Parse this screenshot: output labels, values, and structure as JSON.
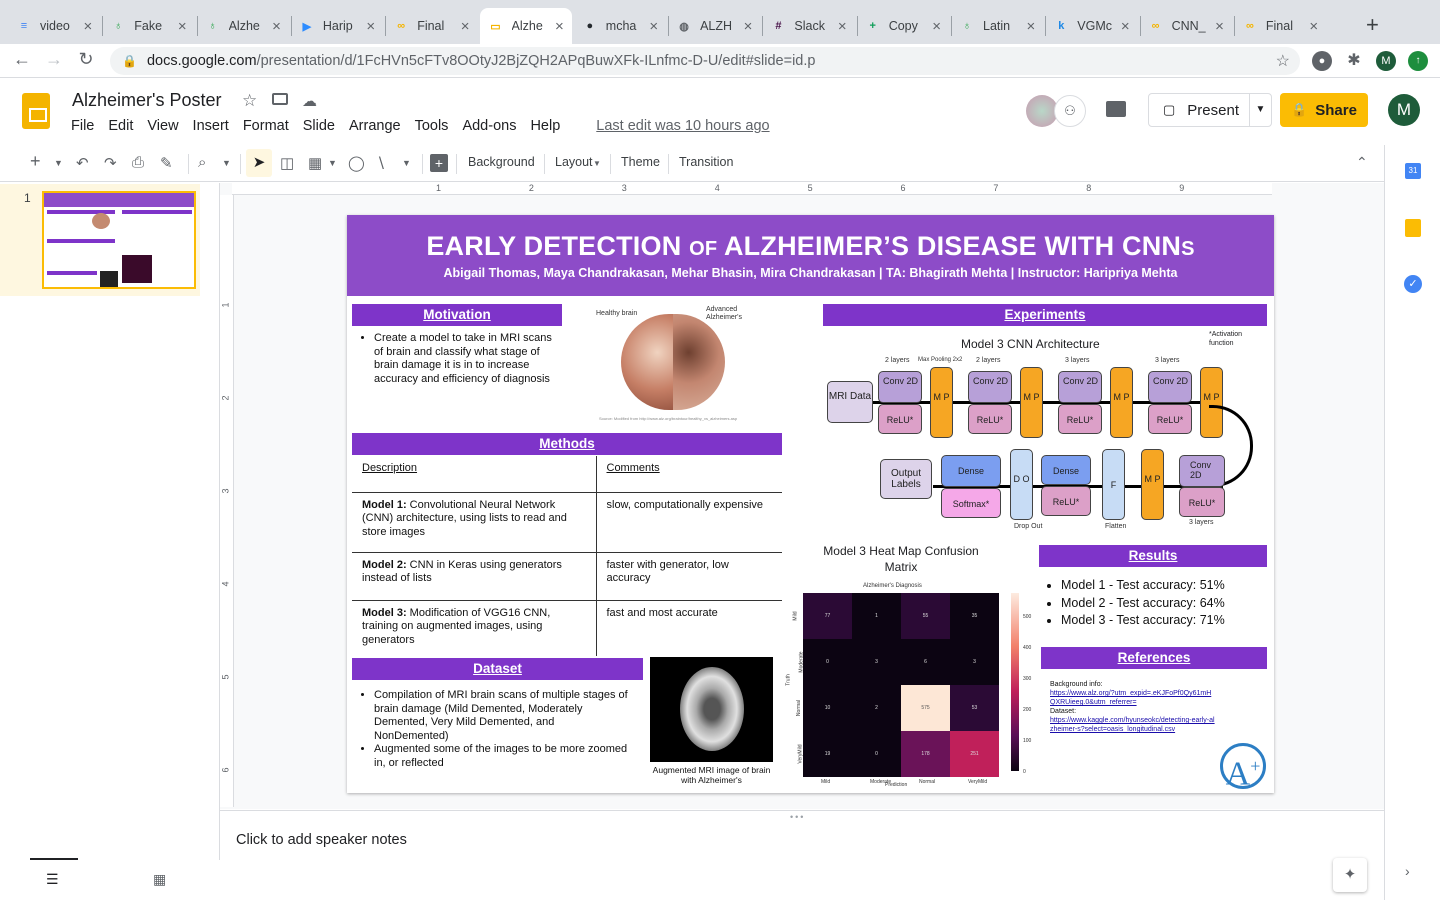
{
  "browser": {
    "tabs": [
      {
        "label": "video",
        "icon": "docs-icon",
        "color": "#4285f4"
      },
      {
        "label": "Fake",
        "icon": "leaf-icon",
        "color": "#34a853"
      },
      {
        "label": "Alzhe",
        "icon": "leaf-icon",
        "color": "#34a853"
      },
      {
        "label": "Harip",
        "icon": "zoom-icon",
        "color": "#2d8cff"
      },
      {
        "label": "Final",
        "icon": "infinity-icon",
        "color": "#f4b400"
      },
      {
        "label": "Alzhe",
        "icon": "slides-icon",
        "color": "#f4b400",
        "active": true
      },
      {
        "label": "mcha",
        "icon": "github-icon",
        "color": "#24292e"
      },
      {
        "label": "ALZH",
        "icon": "globe-icon",
        "color": "#5f6368"
      },
      {
        "label": "Slack",
        "icon": "slack-icon",
        "color": "#4a154b"
      },
      {
        "label": "Copy",
        "icon": "sheets-icon",
        "color": "#0f9d58"
      },
      {
        "label": "Latin",
        "icon": "leaf-icon",
        "color": "#34a853"
      },
      {
        "label": "VGMc",
        "icon": "k-icon",
        "color": "#1e88e5"
      },
      {
        "label": "CNN_",
        "icon": "infinity-icon",
        "color": "#f4b400"
      },
      {
        "label": "Final",
        "icon": "infinity-icon",
        "color": "#f4b400"
      }
    ],
    "url_host": "docs.google.com",
    "url_path": "/presentation/d/1FcHVn5cFTv8OOtyJ2BjZQH2APqBuwXFk-ILnfmc-D-U/edit#slide=id.p",
    "profile_initial": "M"
  },
  "app": {
    "doc_title": "Alzheimer's Poster",
    "menu": [
      "File",
      "Edit",
      "View",
      "Insert",
      "Format",
      "Slide",
      "Arrange",
      "Tools",
      "Add-ons",
      "Help"
    ],
    "last_edit": "Last edit was 10 hours ago",
    "present_label": "Present",
    "share_label": "Share",
    "avatar_initial": "M"
  },
  "toolbar": {
    "background": "Background",
    "layout": "Layout",
    "theme": "Theme",
    "transition": "Transition"
  },
  "filmstrip": {
    "slide_number": "1"
  },
  "ruler": {
    "top": [
      "1",
      "2",
      "3",
      "4",
      "5",
      "6",
      "7",
      "8",
      "9"
    ],
    "left": [
      "1",
      "2",
      "3",
      "4",
      "5",
      "6"
    ]
  },
  "poster": {
    "title_part1": "EARLY DETECTION",
    "title_of": "OF",
    "title_part2": "ALZHEIMER’S DISEASE WITH CNN",
    "title_s": "S",
    "authors": "Abigail Thomas, Maya Chandrakasan, Mehar Bhasin, Mira Chandrakasan | TA: Bhagirath Mehta | Instructor: Haripriya Mehta",
    "motivation": {
      "heading": "Motivation",
      "text": "Create a model to take in MRI scans of brain and classify what stage of brain damage it is in to increase accuracy and efficiency of diagnosis",
      "img_left": "Healthy brain",
      "img_right": "Advanced Alzheimer's",
      "img_source": "Source: Modified from http://www.alz.org/braintour/healthy_vs_alzheimers.asp"
    },
    "methods": {
      "heading": "Methods",
      "col1": "Description",
      "col2": "Comments",
      "rows": [
        {
          "bold": "Model 1:",
          "desc": " Convolutional Neural Network (CNN) architecture, using lists to read and store images",
          "comment": "slow, computationally expensive"
        },
        {
          "bold": "Model 2:",
          "desc": " CNN in Keras using generators instead of lists",
          "comment": "faster with generator, low accuracy"
        },
        {
          "bold": "Model 3:",
          "desc": " Modification of VGG16 CNN, training on augmented images, using generators",
          "comment": "fast and most accurate"
        }
      ]
    },
    "dataset": {
      "heading": "Dataset",
      "bullets": [
        "Compilation of MRI brain scans of multiple stages of brain damage (Mild Demented, Moderately Demented, Very Mild Demented, and NonDemented)",
        "Augmented some of the images to be more zoomed in, or reflected"
      ],
      "caption": "Augmented MRI image of brain with Alzheimer's"
    },
    "experiments": {
      "heading": "Experiments",
      "arch_title": "Model 3 CNN Architecture",
      "activation_note": "*Activation function",
      "mri": "MRI Data",
      "conv": "Conv 2D",
      "relu": "ReLU*",
      "mp": "M P",
      "two_layers": "2 layers",
      "three_layers": "3 layers",
      "max_pool": "Max Pooling 2x2",
      "dense": "Dense",
      "softmax": "Softmax*",
      "dropout": "D O",
      "dropout_label": "Drop Out",
      "flatten": "F",
      "flatten_label": "Flatten",
      "output": "Output Labels"
    },
    "heatmap": {
      "title": "Model 3 Heat Map Confusion Matrix",
      "top_label": "Alzheimer's Diagnosis",
      "y_axis": "Truth",
      "x_axis": "Prediction",
      "rows": [
        "Mild",
        "Moderate",
        "Normal",
        "VeryMild"
      ],
      "cols": [
        "Mild",
        "Moderate",
        "Normal",
        "VeryMild"
      ],
      "values": [
        [
          77,
          1,
          55,
          35
        ],
        [
          0,
          3,
          6,
          3
        ],
        [
          10,
          2,
          575,
          53
        ],
        [
          19,
          0,
          178,
          251
        ]
      ],
      "scale": [
        "500",
        "400",
        "300",
        "200",
        "100",
        "0"
      ]
    },
    "results": {
      "heading": "Results",
      "items": [
        "Model 1 - Test accuracy: 51%",
        "Model 2 - Test accuracy: 64%",
        "Model 3 - Test accuracy: 71%"
      ]
    },
    "references": {
      "heading": "References",
      "bg_label": "Background info:",
      "bg_link": "https://www.alz.org/?utm_expid=.eKJFoPf0Qy61mHQXRUieeg.0&utm_referrer=",
      "ds_label": "Dataset:",
      "ds_link": "https://www.kaggle.com/hyunseokc/detecting-early-alzheimer-s?select=oasis_longitudinal.csv"
    }
  },
  "notes": {
    "placeholder": "Click to add speaker notes"
  }
}
